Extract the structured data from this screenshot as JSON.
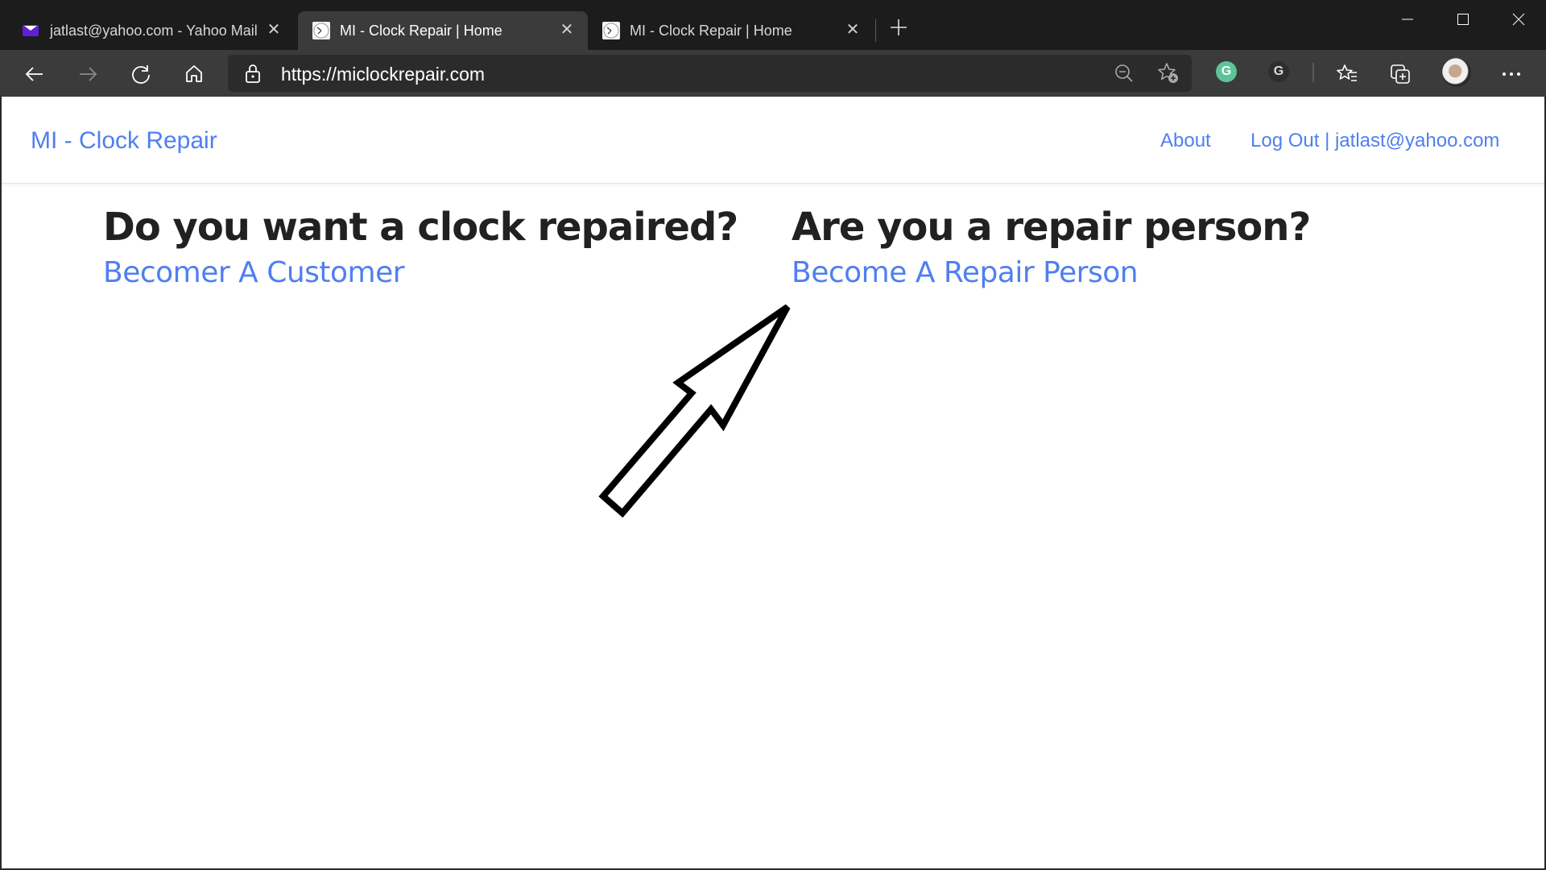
{
  "browser": {
    "tabs": [
      {
        "label": "jatlast@yahoo.com - Yahoo Mail",
        "icon": "mail-icon",
        "active": false
      },
      {
        "label": "MI - Clock Repair | Home",
        "icon": "clock-icon",
        "active": true
      },
      {
        "label": "MI - Clock Repair | Home",
        "icon": "clock-icon",
        "active": false
      }
    ],
    "new_tab_label": "+",
    "address": {
      "scheme": "https://",
      "host": "miclockrepair.com"
    },
    "window_controls": {
      "minimize": "—",
      "maximize": "☐",
      "close": "✕"
    },
    "colors": {
      "tab_strip": "#1c1c1c",
      "toolbar": "#3b3b3b",
      "address_bar": "#2b2b2b",
      "grammarly": "#5fc39a"
    }
  },
  "site": {
    "brand": "MI - Clock Repair",
    "nav": {
      "about": "About",
      "logout": "Log Out | jatlast@yahoo.com"
    },
    "sections": [
      {
        "heading": "Do you want a clock repaired?",
        "link": "Becomer A Customer"
      },
      {
        "heading": "Are you a repair person?",
        "link": "Become A Repair Person"
      }
    ],
    "annotation": "arrow-pointing-to-become-a-repair-person",
    "colors": {
      "link": "#4f7ff0",
      "heading": "#212121"
    }
  }
}
